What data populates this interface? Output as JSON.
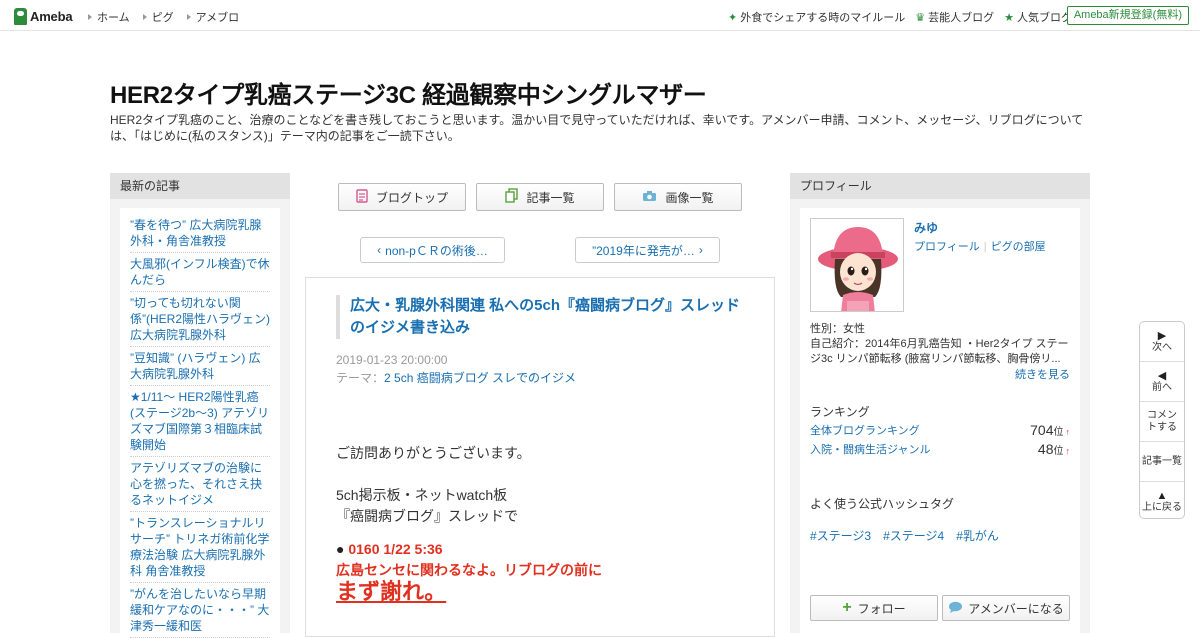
{
  "topbar": {
    "logo": "Ameba",
    "nav": [
      "ホーム",
      "ピグ",
      "アメブロ"
    ],
    "right": [
      {
        "label": "外食でシェアする時のマイルール",
        "icon": "sparkle-icon"
      },
      {
        "label": "芸能人ブログ",
        "icon": "crown-icon"
      },
      {
        "label": "人気ブログ",
        "icon": "star-icon"
      }
    ],
    "signup": "Ameba新規登録(無料)"
  },
  "header": {
    "title": "HER2タイプ乳癌ステージ3C 経過観察中シングルマザー",
    "description": "HER2タイプ乳癌のこと、治療のことなどを書き残しておこうと思います。温かい目で見守っていただければ、幸いです。アメンバー申請、コメント、メッセージ、リブログについては、「はじめに(私のスタンス)」テーマ内の記事をご一読下さい。"
  },
  "recent": {
    "heading": "最新の記事",
    "items": [
      "”春を待つ” 広大病院乳腺外科・角舎准教授",
      "大風邪(インフル検査)で休んだら",
      "”切っても切れない関係”(HER2陽性ハラヴェン) 広大病院乳腺外科",
      "”豆知識” (ハラヴェン) 広大病院乳腺外科",
      "★1/11～ HER2陽性乳癌(ステージ2b～3) アテゾリズマブ国際第３相臨床試験開始",
      "アテゾリズマブの治験に心を撚った、それさえ抉るネットイジメ",
      "”トランスレーショナルリサーチ” トリネガ術前化学療法治験 広大病院乳腺外科 角舎准教授",
      "”がんを治したいなら早期緩和ケアなのに・・・” 大津秀一緩和医"
    ]
  },
  "center": {
    "buttons": [
      "ブログトップ",
      "記事一覧",
      "画像一覧"
    ],
    "prev": "non-pＣＲの術後…",
    "next": "”2019年に発売が…"
  },
  "article": {
    "title": "広大・乳腺外科関連 私への5ch『癌闘病ブログ』スレッドのイジメ書き込み",
    "date": "2019-01-23 20:00:00",
    "theme_label": "テーマ：",
    "theme": "2 5ch 癌闘病ブログ スレでのイジメ",
    "line1": "ご訪問ありがとうございます。",
    "line2": "5ch掲示板・ネットwatch板",
    "line3": "『癌闘病ブログ』スレッドで",
    "quote_head": "0160 1/22 5:36",
    "quote_body": "広島センセに関わるなよ。リブログの前に",
    "quote_big": "まず謝れ。"
  },
  "profile": {
    "heading": "プロフィール",
    "name": "みゆ",
    "link1": "プロフィール",
    "link2": "ピグの部屋",
    "gender": "性別：女性",
    "intro": "自己紹介：2014年6月乳癌告知 ・Her2タイプ ステージ3c リンパ節転移 (腋窩リンパ節転移、胸骨傍リ...",
    "more": "続きを見る",
    "ranking_heading": "ランキング",
    "rankings": [
      {
        "label": "全体ブログランキング",
        "rank": "704",
        "unit": "位"
      },
      {
        "label": "入院・闘病生活ジャンル",
        "rank": "48",
        "unit": "位"
      }
    ],
    "hashtag_heading": "よく使う公式ハッシュタグ",
    "hashtags": [
      "#ステージ3",
      "#ステージ4",
      "#乳がん"
    ],
    "follow": "フォロー",
    "amember": "アメンバーになる"
  },
  "sidenav": {
    "next": "次へ",
    "prev": "前へ",
    "comment": "コメントする",
    "list": "記事一覧",
    "top": "上に戻る"
  },
  "colors": {
    "brand_green": "#2d8c3c",
    "link_blue": "#1a6fb0",
    "alert_red": "#e03020"
  }
}
